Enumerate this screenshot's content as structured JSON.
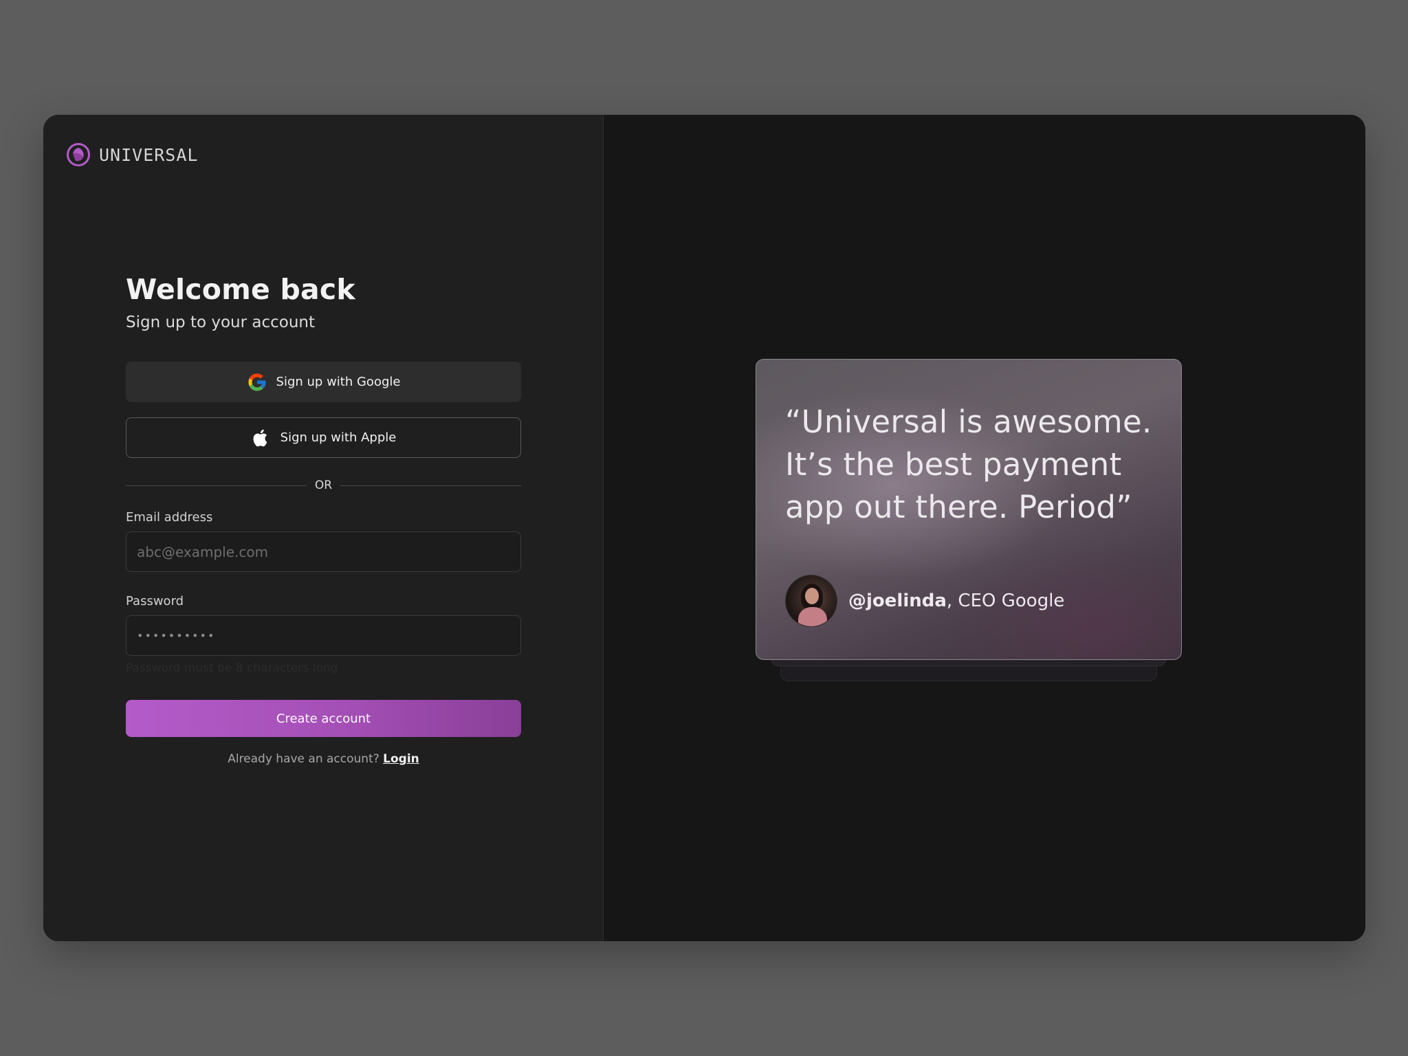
{
  "brand": {
    "name": "UNIVERSAL",
    "accent_color": "#b45bc9",
    "icon": "universal-logo-icon"
  },
  "form": {
    "title": "Welcome back",
    "subtitle": "Sign up to your account",
    "google_button": {
      "label": "Sign up with Google",
      "icon": "google-icon"
    },
    "apple_button": {
      "label": "Sign up with Apple",
      "icon": "apple-icon"
    },
    "divider_text": "OR",
    "email": {
      "label": "Email address",
      "placeholder": "abc@example.com",
      "value": ""
    },
    "password": {
      "label": "Password",
      "masked_value": "••••••••••",
      "hint": "Password must be 8 characters long"
    },
    "submit_label": "Create account",
    "login_prompt": "Already have an account?",
    "login_link": "Login"
  },
  "testimonial": {
    "quote": "“Universal is awesome. It’s the best payment app out there. Period”",
    "handle": "@joelinda",
    "role": ", CEO Google"
  }
}
